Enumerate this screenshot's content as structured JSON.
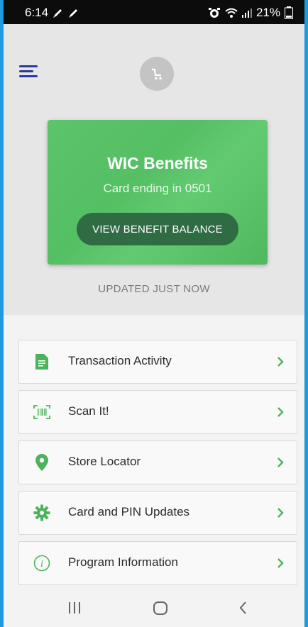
{
  "status_bar": {
    "time": "6:14",
    "battery": "21%"
  },
  "header": {
    "menu_icon": "hamburger-icon",
    "cart_icon": "cart-icon"
  },
  "card": {
    "title": "WIC Benefits",
    "subtitle": "Card ending in 0501",
    "button_label": "VIEW BENEFIT BALANCE",
    "updated_text": "UPDATED JUST NOW"
  },
  "menu_items": [
    {
      "label": "Transaction Activity",
      "icon": "document-icon"
    },
    {
      "label": "Scan It!",
      "icon": "barcode-scan-icon"
    },
    {
      "label": "Store Locator",
      "icon": "location-pin-icon"
    },
    {
      "label": "Card and PIN Updates",
      "icon": "gear-icon"
    },
    {
      "label": "Program Information",
      "icon": "info-icon"
    }
  ],
  "colors": {
    "accent_green": "#4bb45a",
    "card_green": "#5cc46c",
    "button_dark_green": "#2f6b43",
    "menu_blue": "#2b3c9a",
    "frame_blue": "#1e9be0"
  }
}
